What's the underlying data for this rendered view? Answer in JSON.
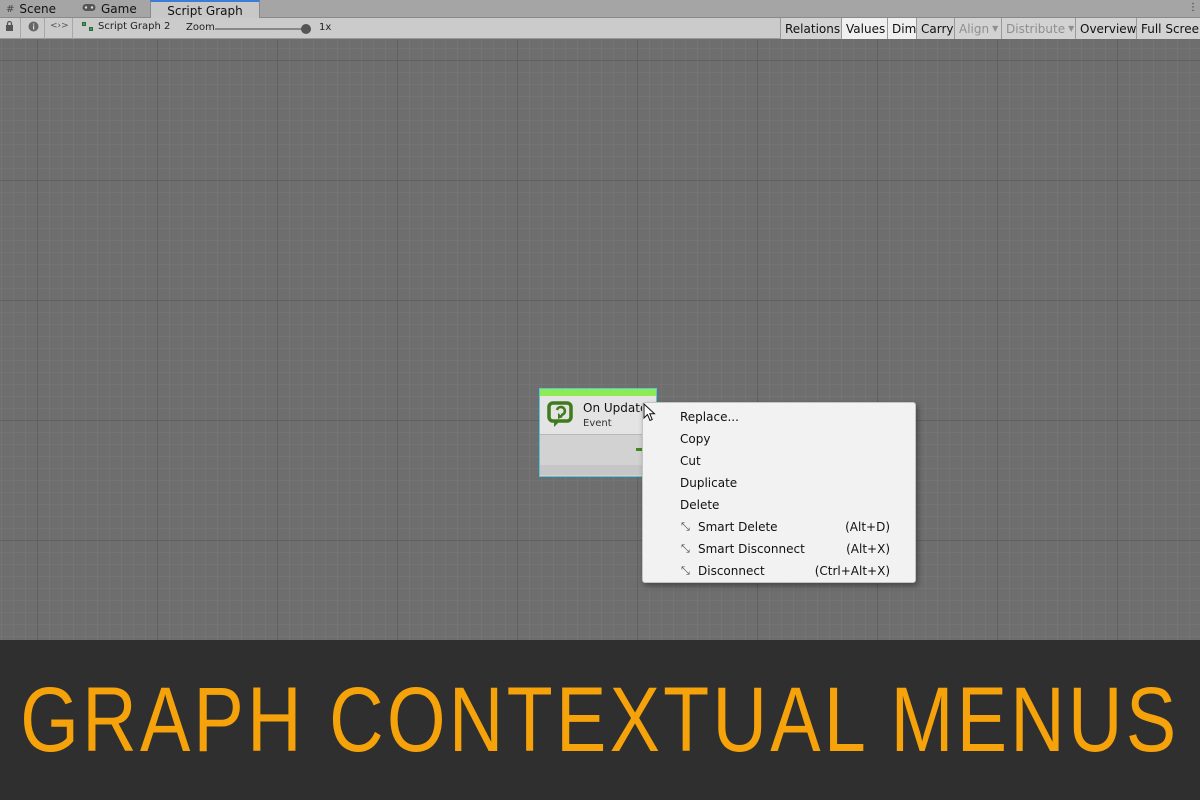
{
  "tabs": [
    {
      "label": "Scene",
      "icon": "grid-icon"
    },
    {
      "label": "Game",
      "icon": "gamepad-icon"
    },
    {
      "label": "Script Graph",
      "icon": "",
      "active": true
    }
  ],
  "toolbar": {
    "breadcrumb": "Script Graph 2",
    "zoom_label": "Zoom",
    "zoom_value": "1x",
    "zoom_fraction": 1.0,
    "buttons": [
      {
        "label": "Relations",
        "state": "normal"
      },
      {
        "label": "Values",
        "state": "on"
      },
      {
        "label": "Dim",
        "state": "on"
      },
      {
        "label": "Carry",
        "state": "normal"
      },
      {
        "label": "Align",
        "state": "disabled",
        "dropdown": true
      },
      {
        "label": "Distribute",
        "state": "disabled",
        "dropdown": true
      },
      {
        "label": "Overview",
        "state": "normal"
      },
      {
        "label": "Full Screen",
        "state": "normal"
      }
    ]
  },
  "node": {
    "title": "On Update",
    "subtitle": "Event",
    "accent_color": "#8dec55",
    "icon": "event-loop-icon"
  },
  "context_menu": {
    "items": [
      {
        "label": "Replace...",
        "shortcut": ""
      },
      {
        "label": "Copy",
        "shortcut": ""
      },
      {
        "label": "Cut",
        "shortcut": ""
      },
      {
        "label": "Duplicate",
        "shortcut": ""
      },
      {
        "label": "Delete",
        "shortcut": ""
      },
      {
        "label": "Smart Delete",
        "shortcut": "(Alt+D)",
        "icon": "disconnect-icon"
      },
      {
        "label": "Smart Disconnect",
        "shortcut": "(Alt+X)",
        "icon": "disconnect-icon"
      },
      {
        "label": "Disconnect",
        "shortcut": "(Ctrl+Alt+X)",
        "icon": "disconnect-icon"
      }
    ]
  },
  "banner": {
    "text": "GRAPH CONTEXTUAL MENUS",
    "color": "#f5a20b"
  }
}
